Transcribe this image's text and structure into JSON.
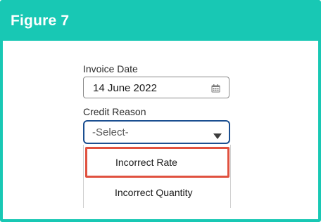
{
  "figure": {
    "title": "Figure 7"
  },
  "form": {
    "invoice_date_label": "Invoice Date",
    "invoice_date_value": "14 June 2022",
    "credit_reason_label": "Credit Reason",
    "credit_reason_value": "-Select-",
    "credit_reason_options": [
      "Incorrect Rate",
      "Incorrect Quantity"
    ],
    "highlighted_option": "Incorrect Rate"
  },
  "icons": {
    "date_field": "calendar-icon",
    "select_field": "chevron-down-icon"
  },
  "colors": {
    "banner": "#18c8b4",
    "select_focus_border": "#1b4f91",
    "highlight_border": "#e0513f"
  }
}
